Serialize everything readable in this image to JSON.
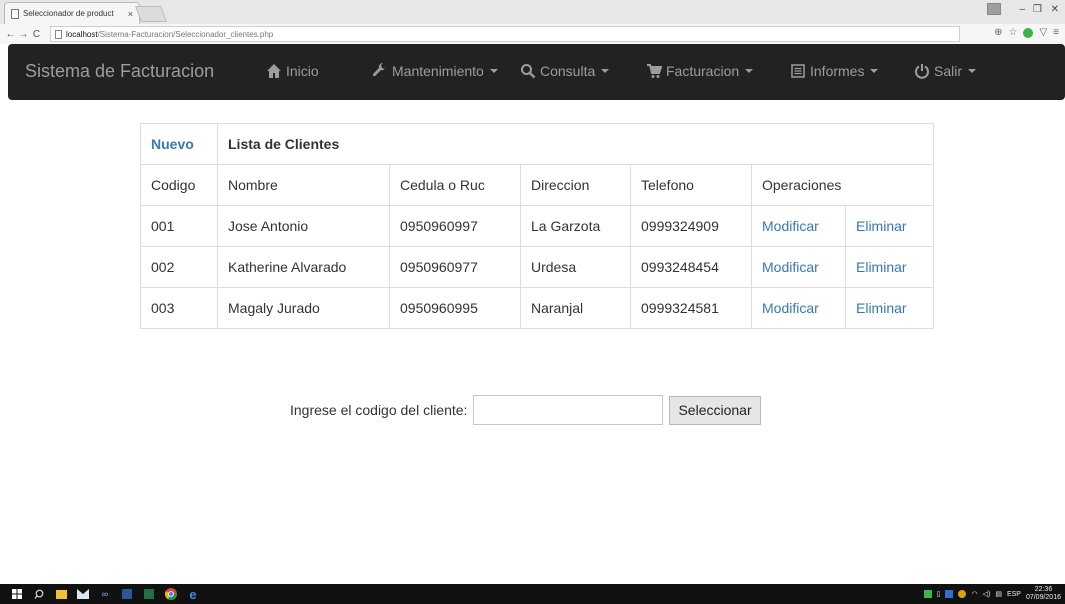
{
  "browser": {
    "tab_title": "Seleccionador de product",
    "tab_close": "×",
    "url_host": "localhost",
    "url_path": "/Sistema-Facturacion/Seleccionador_clientes.php",
    "window_controls": {
      "minimize": "–",
      "maximize": "❐",
      "close": "✕"
    }
  },
  "navbar": {
    "brand": "Sistema de Facturacion",
    "items": [
      {
        "label": "Inicio",
        "icon": "home-icon",
        "dropdown": false
      },
      {
        "label": "Mantenimiento",
        "icon": "wrench-icon",
        "dropdown": true
      },
      {
        "label": "Consulta",
        "icon": "search-icon",
        "dropdown": true
      },
      {
        "label": "Facturacion",
        "icon": "cart-icon",
        "dropdown": true
      },
      {
        "label": "Informes",
        "icon": "list-icon",
        "dropdown": true
      },
      {
        "label": "Salir",
        "icon": "power-icon",
        "dropdown": true
      }
    ]
  },
  "table": {
    "new_link": "Nuevo",
    "title": "Lista de Clientes",
    "headers": [
      "Codigo",
      "Nombre",
      "Cedula o Ruc",
      "Direccion",
      "Telefono",
      "Operaciones"
    ],
    "rows": [
      {
        "codigo": "001",
        "nombre": "Jose Antonio",
        "cedula": "0950960997",
        "direccion": "La Garzota",
        "telefono": "0999324909",
        "modificar": "Modificar",
        "eliminar": "Eliminar"
      },
      {
        "codigo": "002",
        "nombre": "Katherine Alvarado",
        "cedula": "0950960977",
        "direccion": "Urdesa",
        "telefono": "0993248454",
        "modificar": "Modificar",
        "eliminar": "Eliminar"
      },
      {
        "codigo": "003",
        "nombre": "Magaly Jurado",
        "cedula": "0950960995",
        "direccion": "Naranjal",
        "telefono": "0999324581",
        "modificar": "Modificar",
        "eliminar": "Eliminar"
      }
    ]
  },
  "form": {
    "label": "Ingrese el codigo del cliente:",
    "input_value": "",
    "button_label": "Seleccionar"
  },
  "taskbar": {
    "lang": "ESP",
    "time": "22:36",
    "date": "07/09/2016"
  },
  "colors": {
    "navbar_bg": "#222222",
    "navbar_text": "#9d9d9d",
    "link": "#337ab7",
    "border": "#dddddd"
  }
}
